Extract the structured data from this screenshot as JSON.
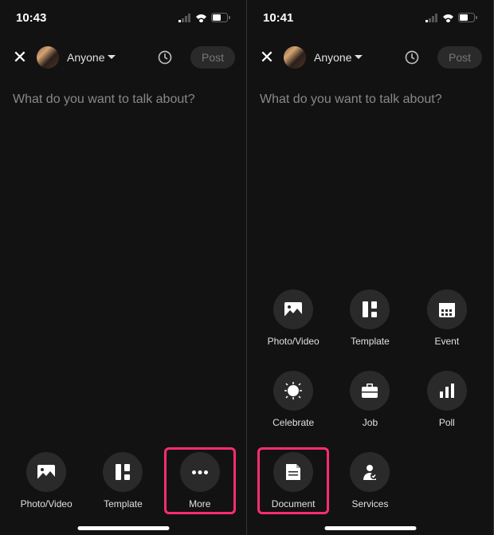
{
  "left": {
    "time": "10:43",
    "audience": "Anyone",
    "post": "Post",
    "placeholder": "What do you want to talk about?",
    "tools": [
      {
        "label": "Photo/Video"
      },
      {
        "label": "Template"
      },
      {
        "label": "More"
      }
    ]
  },
  "right": {
    "time": "10:41",
    "audience": "Anyone",
    "post": "Post",
    "placeholder": "What do you want to talk about?",
    "tools": [
      {
        "label": "Photo/Video"
      },
      {
        "label": "Template"
      },
      {
        "label": "Event"
      },
      {
        "label": "Celebrate"
      },
      {
        "label": "Job"
      },
      {
        "label": "Poll"
      },
      {
        "label": "Document"
      },
      {
        "label": "Services"
      }
    ]
  }
}
